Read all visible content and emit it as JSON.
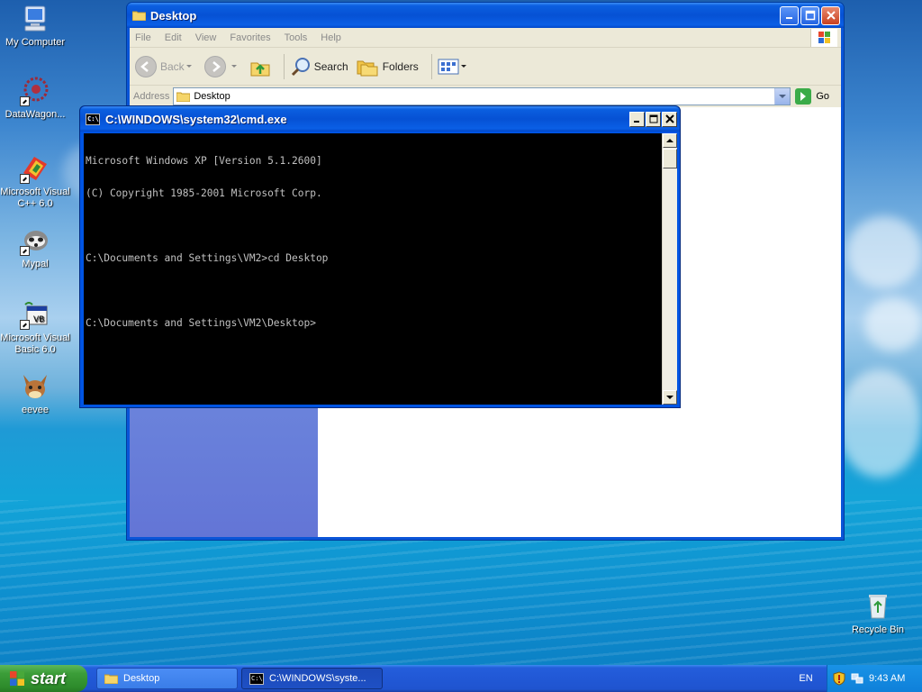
{
  "desktop": {
    "icons": [
      {
        "label": "My Computer"
      },
      {
        "label": "DataWagon..."
      },
      {
        "label": "Microsoft Visual C++ 6.0"
      },
      {
        "label": "Mypal"
      },
      {
        "label": "Microsoft Visual Basic 6.0"
      },
      {
        "label": "eevee"
      },
      {
        "label": "Recycle Bin"
      }
    ]
  },
  "explorer": {
    "title": "Desktop",
    "menu": [
      "File",
      "Edit",
      "View",
      "Favorites",
      "Tools",
      "Help"
    ],
    "toolbar": {
      "back": "Back",
      "search": "Search",
      "folders": "Folders"
    },
    "address": {
      "label": "Address",
      "value": "Desktop",
      "go": "Go"
    }
  },
  "cmd": {
    "title": "C:\\WINDOWS\\system32\\cmd.exe",
    "icon_text": "C:\\",
    "lines": [
      "Microsoft Windows XP [Version 5.1.2600]",
      "(C) Copyright 1985-2001 Microsoft Corp.",
      "",
      "C:\\Documents and Settings\\VM2>cd Desktop",
      "",
      "C:\\Documents and Settings\\VM2\\Desktop>"
    ]
  },
  "taskbar": {
    "start": "start",
    "tasks": [
      {
        "label": "Desktop"
      },
      {
        "label": "C:\\WINDOWS\\syste..."
      }
    ],
    "language": "EN",
    "clock": "9:43 AM"
  },
  "colors": {
    "xp_title_blue": "#0a55d8",
    "console_bg": "#000000",
    "console_fg": "#c0c0c0",
    "start_green": "#3c9e39",
    "taskbar_blue": "#245edb"
  }
}
